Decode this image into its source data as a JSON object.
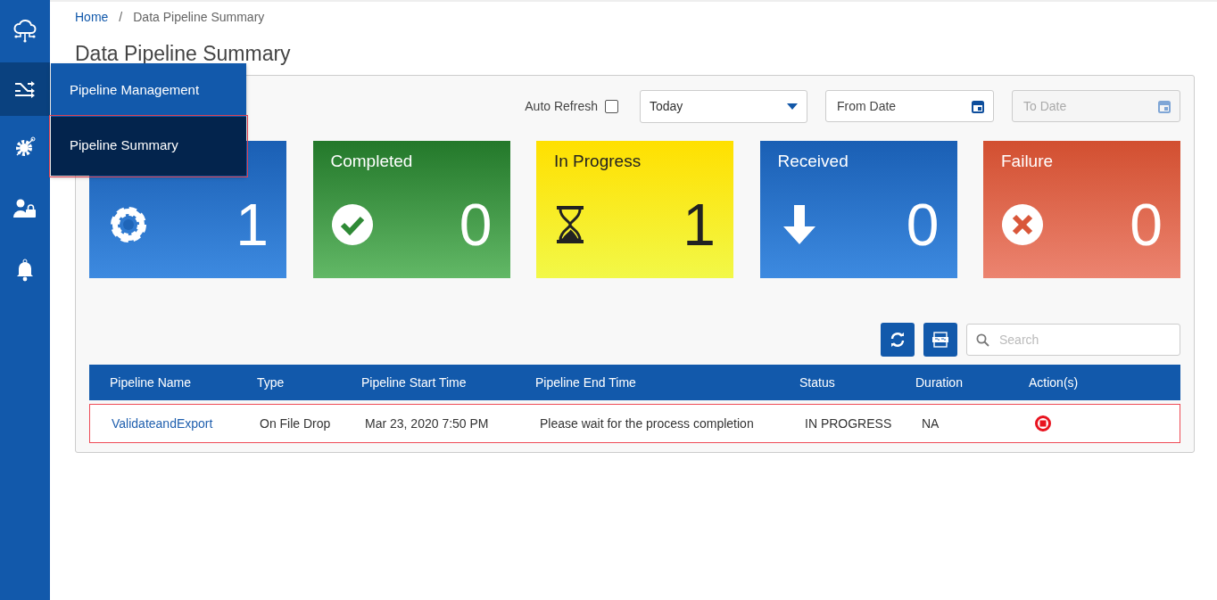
{
  "sidebar": {
    "items": [
      {
        "kind": "logo",
        "selected": false
      },
      {
        "kind": "shuffle",
        "selected": true
      },
      {
        "kind": "gear-network",
        "selected": false
      },
      {
        "kind": "user-lock",
        "selected": false
      },
      {
        "kind": "bell",
        "selected": false
      }
    ]
  },
  "flyout_menu": {
    "items": [
      {
        "label": "Pipeline Management",
        "selected": false
      },
      {
        "label": "Pipeline Summary",
        "selected": true
      }
    ]
  },
  "breadcrumb": {
    "separator": "/",
    "items": [
      {
        "label": "Home",
        "link": true
      },
      {
        "label": "Data Pipeline Summary",
        "link": false
      }
    ]
  },
  "title": "Data Pipeline Summary",
  "filters": {
    "auto_refresh": {
      "label": "Auto Refresh",
      "checked": false
    },
    "period": {
      "value": "Today"
    },
    "from_date": {
      "placeholder": "From Date",
      "disabled": false
    },
    "to_date": {
      "placeholder": "To Date",
      "disabled": true
    }
  },
  "cards": [
    {
      "kind": "gear",
      "count": "1",
      "color": "#1a5fb4"
    },
    {
      "kind": "check",
      "title": "Completed",
      "count": "0",
      "color": "#23782a"
    },
    {
      "kind": "hourglass",
      "title": "In Progress",
      "count": "1",
      "color": "#ffe000"
    },
    {
      "kind": "arrow-down",
      "title": "Received",
      "count": "0",
      "color": "#1a5fb4"
    },
    {
      "kind": "x",
      "title": "Failure",
      "count": "0",
      "color": "#d24f30"
    }
  ],
  "search": {
    "placeholder": "Search"
  },
  "table": {
    "columns": [
      "Pipeline Name",
      "Type",
      "Pipeline Start Time",
      "Pipeline End Time",
      "Status",
      "Duration",
      "Action(s)"
    ],
    "rows": [
      {
        "name": "ValidateandExport",
        "type": "On File Drop",
        "start_time": "Mar 23, 2020 7:50 PM",
        "end_time": "Please wait for the process completion",
        "status": "IN PROGRESS",
        "duration": "NA",
        "selected": true
      }
    ]
  }
}
